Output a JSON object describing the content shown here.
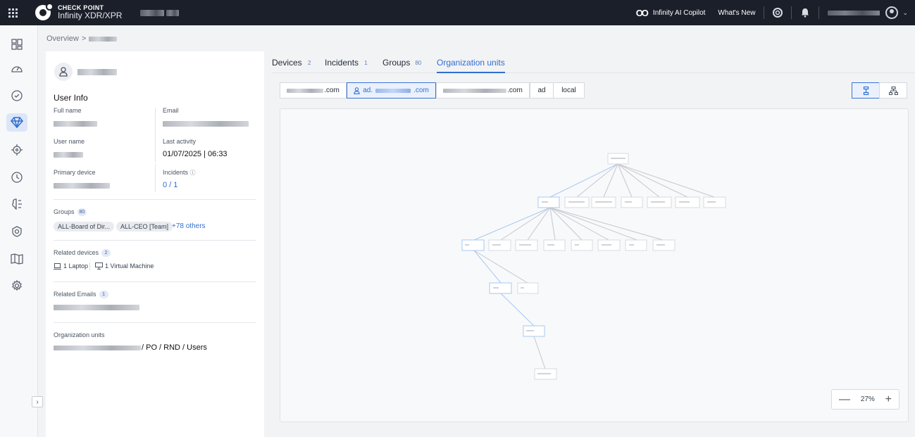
{
  "topbar": {
    "brand_top": "CHECK POINT",
    "brand_bottom": "Infinity XDR/XPR",
    "copilot": "Infinity AI Copilot",
    "whats_new": "What's New"
  },
  "breadcrumb": {
    "root": "Overview",
    "separator": ">"
  },
  "user": {
    "section_title": "User Info",
    "full_name_label": "Full name",
    "email_label": "Email",
    "user_name_label": "User name",
    "last_activity_label": "Last activity",
    "last_activity_value": "01/07/2025 | 06:33",
    "primary_device_label": "Primary device",
    "incidents_label": "Incidents",
    "incidents_value": "0 / 1",
    "groups_label": "Groups",
    "groups_count": "80",
    "group_chips": [
      "ALL-Board of Dir...",
      "ALL-CEO [Team]"
    ],
    "groups_others": "+78 others",
    "related_devices_label": "Related devices",
    "related_devices_count": "2",
    "device_laptop": "1 Laptop",
    "device_vm": "1 Virtual Machine",
    "related_emails_label": "Related Emails",
    "related_emails_count": "1",
    "org_units_label": "Organization units",
    "org_units_path": "/ PO / RND / Users"
  },
  "tabs": [
    {
      "label": "Devices",
      "count": "2"
    },
    {
      "label": "Incidents",
      "count": "1"
    },
    {
      "label": "Groups",
      "count": "80"
    },
    {
      "label": "Organization units",
      "count": ""
    }
  ],
  "domains": [
    ".com",
    "ad.",
    ".com",
    ".com",
    "ad",
    "local"
  ],
  "zoom": {
    "level": "27%",
    "minus": "—",
    "plus": "+"
  },
  "colors": {
    "accent": "#2f6fd1",
    "topbar": "#1b1f2a",
    "edge_highlight": "#a9c8f0",
    "edge": "#c3c7ce"
  },
  "icons": {
    "apps": "apps-grid-icon",
    "copilot": "infinity-icon",
    "help": "lifebuoy-icon",
    "bell": "bell-icon",
    "avatar": "user-circle-icon",
    "user": "user-icon",
    "tree": "tree-view-icon",
    "org": "org-chart-icon"
  }
}
